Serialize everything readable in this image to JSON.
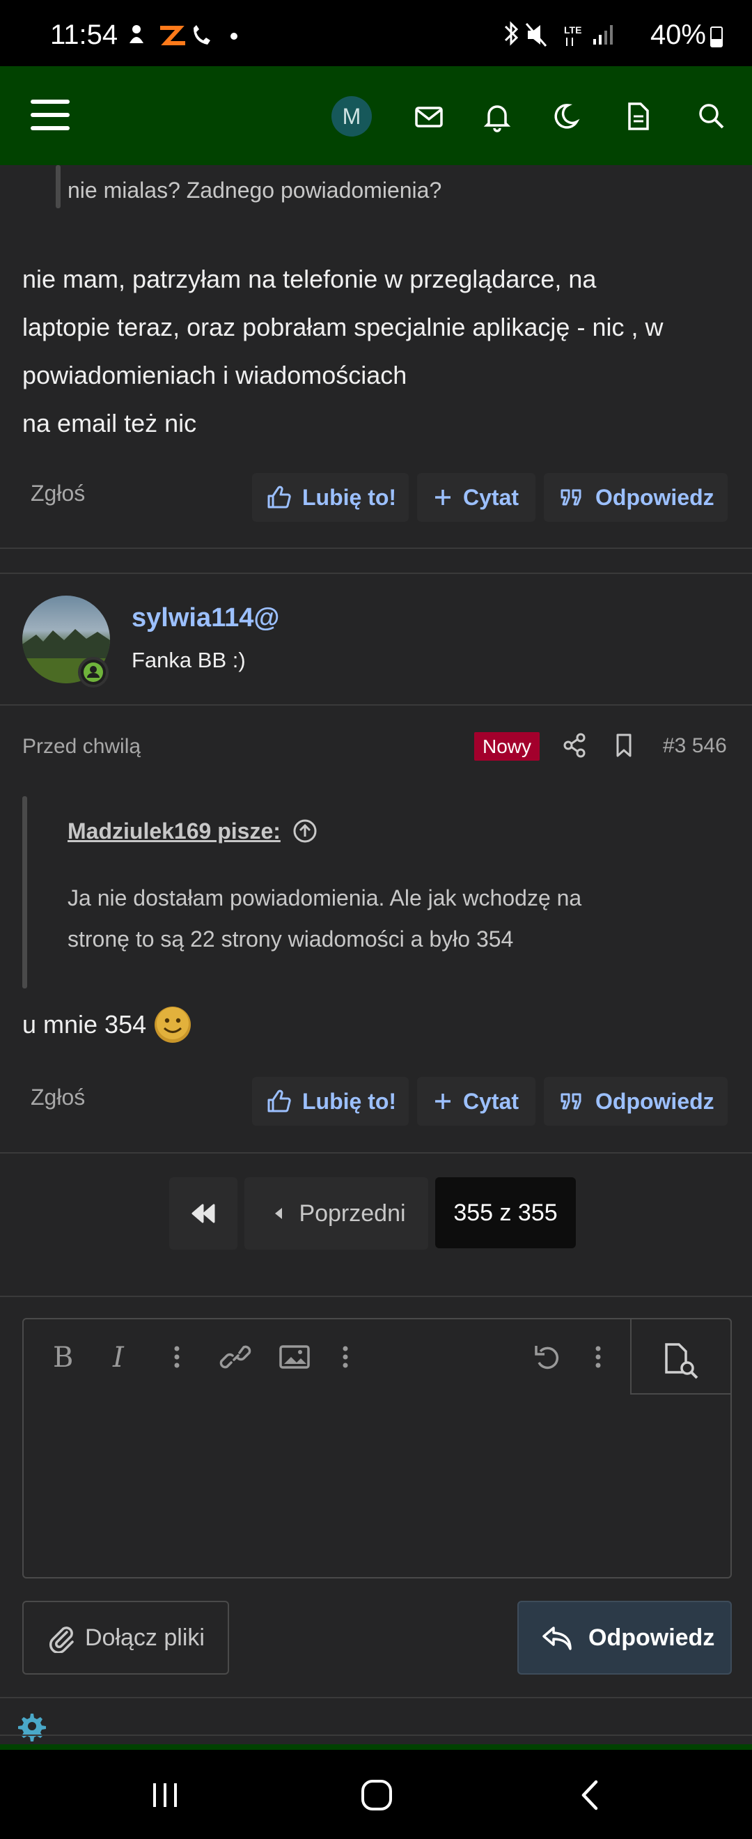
{
  "status_bar": {
    "time": "11:54",
    "battery": "40%",
    "network": "LTE"
  },
  "header": {
    "avatar_letter": "M",
    "icons": [
      "menu-icon",
      "mail-icon",
      "bell-icon",
      "moon-icon",
      "document-icon",
      "search-icon"
    ]
  },
  "post1": {
    "quote_text": "nie mialas? Zadnego powiadomienia?",
    "body_lines": [
      "nie mam, patrzyłam na telefonie w przeglądarce, na",
      "laptopie teraz, oraz pobrałam specjalnie aplikację - nic , w",
      "powiadomieniach i wiadomościach",
      "na email też nic"
    ],
    "report": "Zgłoś",
    "like": "Lubię to!",
    "quote": "Cytat",
    "reply": "Odpowiedz"
  },
  "post2": {
    "username": "sylwia114@",
    "user_title": "Fanka BB :)",
    "time": "Przed chwilą",
    "badge": "Nowy",
    "post_number": "#3 546",
    "quote_author": "Madziulek169 pisze:",
    "quote_lines": [
      "Ja nie dostałam powiadomienia. Ale jak wchodzę na",
      "stronę to są 22 strony wiadomości a było 354"
    ],
    "body": "u mnie 354",
    "report": "Zgłoś",
    "like": "Lubię to!",
    "quote": "Cytat",
    "reply": "Odpowiedz"
  },
  "pagination": {
    "prev": "Poprzedni",
    "current": "355 z 355"
  },
  "editor": {
    "attach": "Dołącz pliki",
    "reply": "Odpowiedz"
  },
  "colors": {
    "header": "#014200",
    "accent_link": "#9cc0ff",
    "badge": "#a3002c",
    "online": "#6fb33b"
  }
}
